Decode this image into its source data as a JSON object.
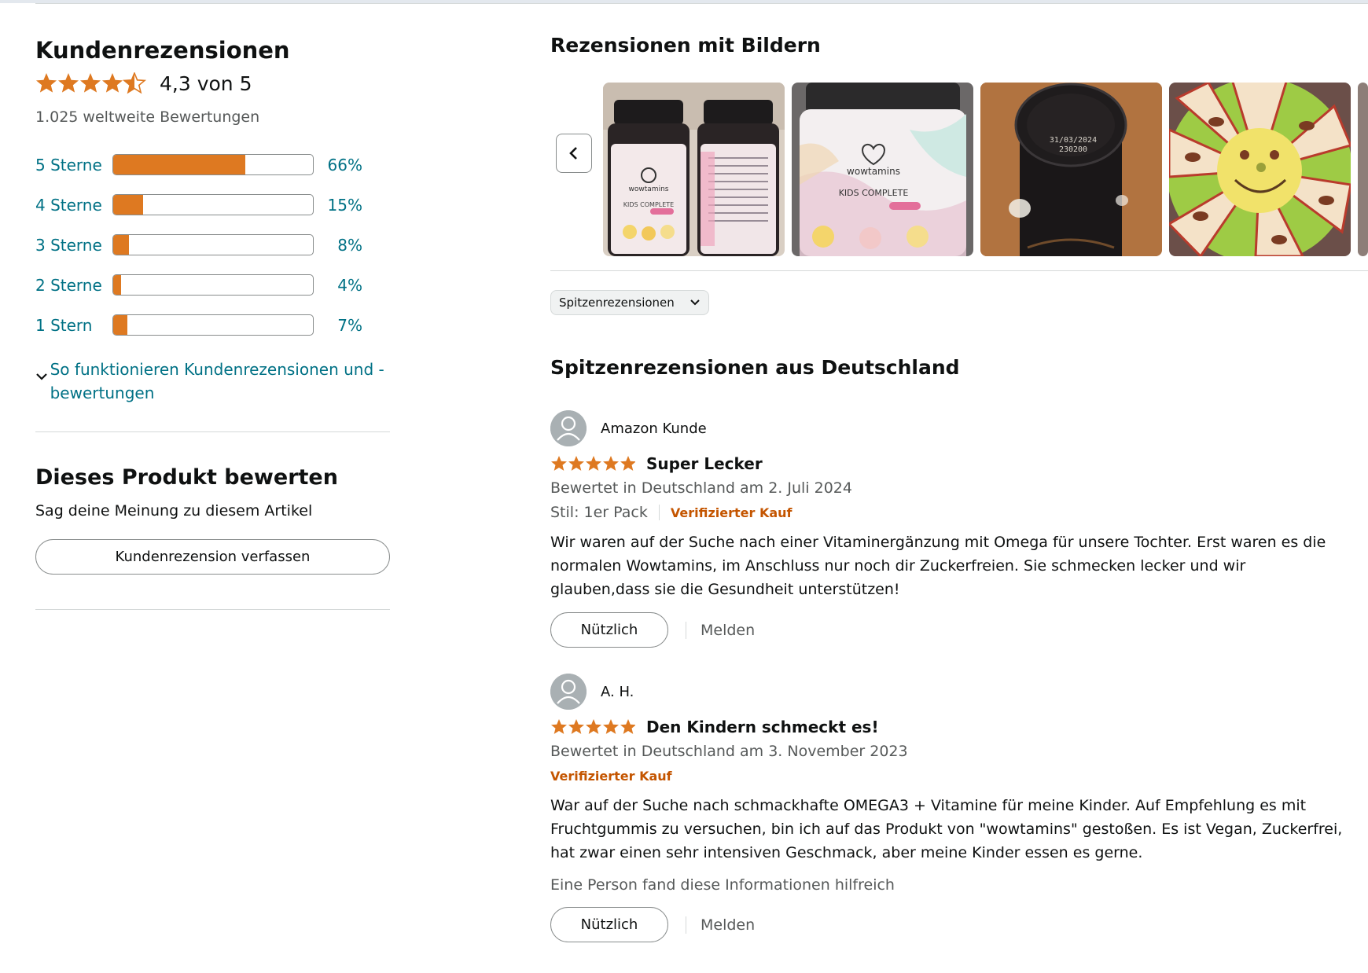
{
  "summary": {
    "title": "Kundenrezensionen",
    "rating_value": 4.3,
    "rating_text": "4,3 von 5",
    "global_count": "1.025 weltweite Bewertungen",
    "histogram": [
      {
        "label": "5 Sterne",
        "percent": 66,
        "percent_text": "66%"
      },
      {
        "label": "4 Sterne",
        "percent": 15,
        "percent_text": "15%"
      },
      {
        "label": "3 Sterne",
        "percent": 8,
        "percent_text": "8%"
      },
      {
        "label": "2 Sterne",
        "percent": 4,
        "percent_text": "4%"
      },
      {
        "label": "1 Stern",
        "percent": 7,
        "percent_text": "7%"
      }
    ],
    "how_reviews_work": "So funktionieren Kundenrezensionen und -bewertungen"
  },
  "write_review": {
    "heading": "Dieses Produkt bewerten",
    "subtext": "Sag deine Meinung zu diesem Artikel",
    "button_label": "Kundenrezension verfassen"
  },
  "images_section": {
    "heading": "Rezensionen mit Bildern",
    "thumb_1_brand": "wowtamins",
    "thumb_1_product": "KIDS COMPLETE",
    "thumb_2_brand": "wowtamins",
    "thumb_2_product": "KIDS COMPLETE",
    "thumb_3_lid_date": "31/03/2024",
    "thumb_3_lid_code": "230200"
  },
  "sort": {
    "selected": "Spitzenrezensionen"
  },
  "top_reviews": {
    "heading": "Spitzenrezensionen aus Deutschland",
    "reviews": [
      {
        "author": "Amazon Kunde",
        "stars": 5,
        "title": "Super Lecker",
        "date": "Bewertet in Deutschland am 2. Juli 2024",
        "style": "Stil: 1er Pack",
        "verified": "Verifizierter Kauf",
        "body": "Wir waren auf der Suche nach einer Vitaminergänzung mit Omega für unsere Tochter. Erst waren es die normalen Wowtamins, im Anschluss nur noch dir Zuckerfreien. Sie schmecken lecker und wir glauben,dass sie die Gesundheit unterstützen!",
        "helpful_button": "Nützlich",
        "report": "Melden"
      },
      {
        "author": "A. H.",
        "stars": 5,
        "title": "Den Kindern schmeckt es!",
        "date": "Bewertet in Deutschland am 3. November 2023",
        "verified": "Verifizierter Kauf",
        "body": "War auf der Suche nach schmackhafte OMEGA3 + Vitamine für meine Kinder. Auf Empfehlung es mit Fruchtgummis zu versuchen, bin ich auf das Produkt von \"wowtamins\" gestoßen. Es ist Vegan, Zuckerfrei, hat zwar einen sehr intensiven Geschmack, aber meine Kinder essen es gerne.",
        "helpful_note": "Eine Person fand diese Informationen hilfreich",
        "helpful_button": "Nützlich",
        "report": "Melden"
      }
    ]
  },
  "colors": {
    "star": "#de7921",
    "link": "#007185",
    "verified": "#c45500",
    "muted": "#565959"
  }
}
